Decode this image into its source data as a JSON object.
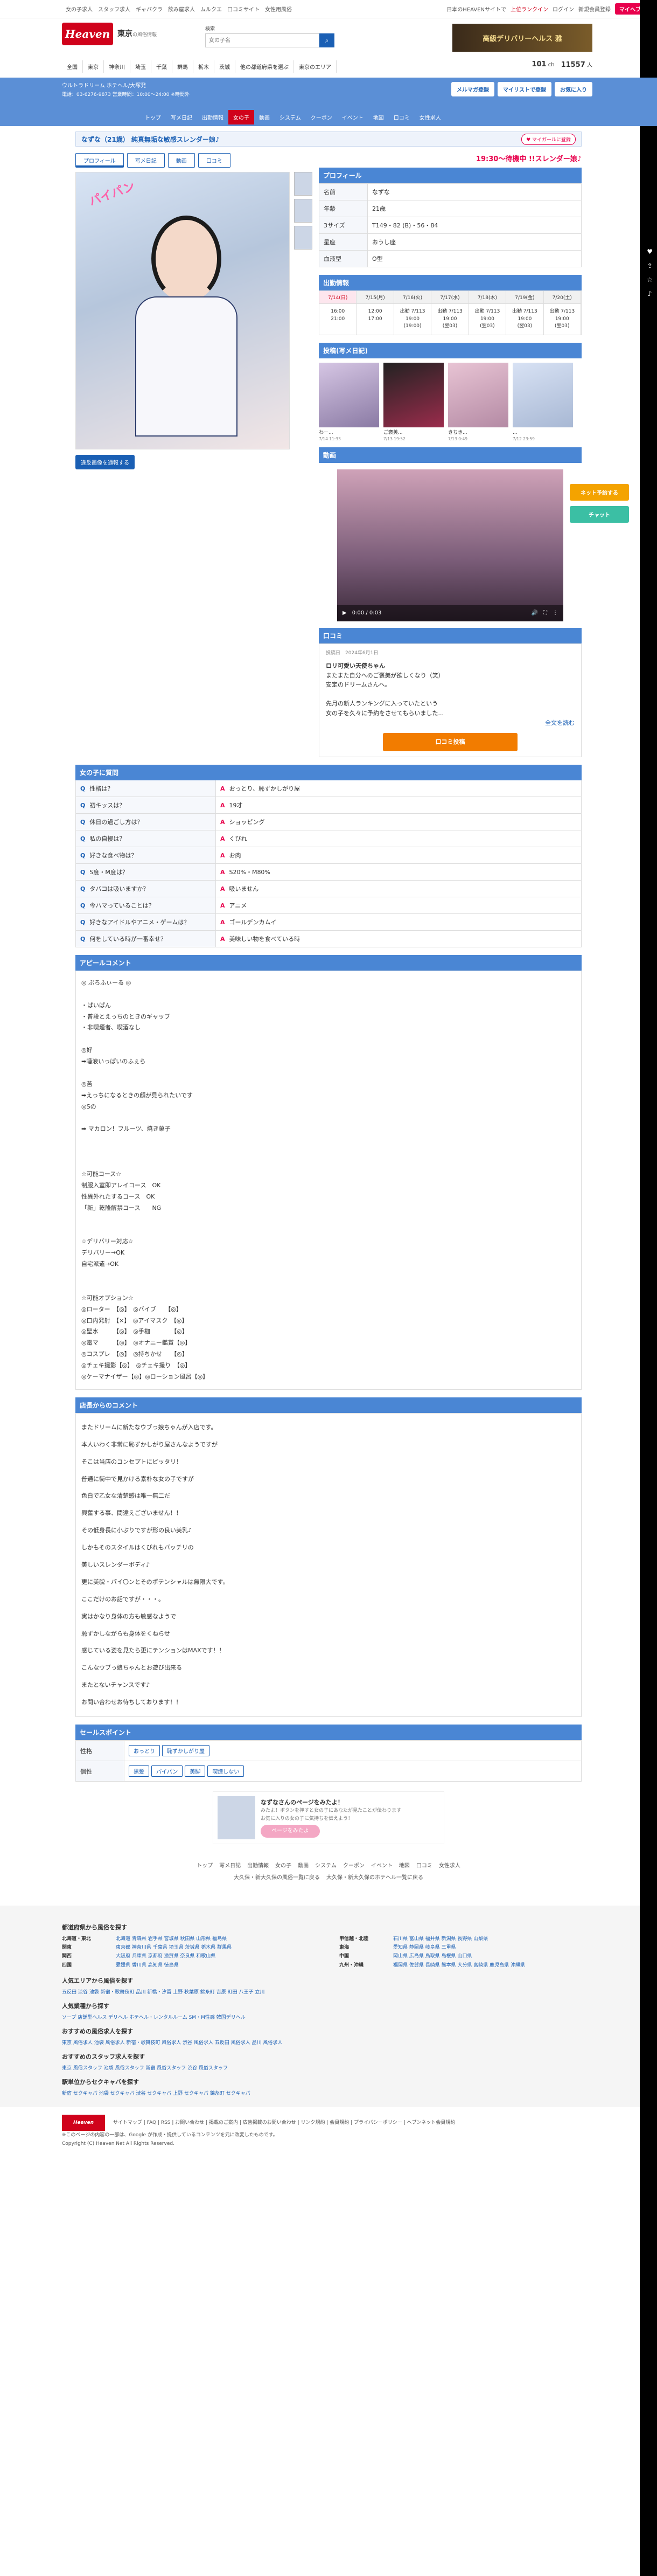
{
  "topbar": {
    "links": [
      "女の子求人",
      "スタッフ求人",
      "ギャバクラ",
      "飲み屋求人",
      "ムルクエ",
      "口コミサイト",
      "女性用風俗"
    ],
    "right_text": "日本のHEAVENサイトで",
    "ranking": "上位ランクイン",
    "login": "ログイン",
    "register": "新規会員登録",
    "mypage": "マイヘブン"
  },
  "header": {
    "logo": "Heaven",
    "region": "東京",
    "region_sub": "の風俗情報",
    "search_label": "検索",
    "search_placeholder": "女の子名",
    "banner_text": "高級デリバリーヘルス 雅",
    "gnav": [
      "全国",
      "東京",
      "神奈川",
      "埼玉",
      "千葉",
      "群馬",
      "栃木",
      "茨城",
      "他の都道府県を選ぶ",
      "東京のエリア"
    ],
    "count1": "101",
    "count1_unit": "ch",
    "count2": "11557",
    "count2_unit": "人"
  },
  "shop": {
    "name": "ウルトラドリーム ホテヘル/大塚発",
    "meta": "電話：03-6276-9873 営業時間：10:00～24:00 ※時間外",
    "btns": [
      "メルマガ登録",
      "マイリストで登録",
      "お気に入り"
    ],
    "nav": [
      "トップ",
      "写メ日記",
      "出勤情報",
      "女の子",
      "動画",
      "システム",
      "クーポン",
      "イベント",
      "地図",
      "口コミ",
      "女性求人"
    ],
    "active_nav": "女の子"
  },
  "girl": {
    "title": "なずな（21歳） 純真無垢な敏感スレンダー娘♪",
    "fav_btn": "♥ マイガールに登録",
    "status": "19:30〜待機中 !!スレンダー娘♪",
    "tabs": [
      "プロフィール",
      "写メ日記",
      "動画",
      "口コミ"
    ],
    "watermark": "パイパン",
    "return_btn": "違反画像を通報する"
  },
  "profile": {
    "header": "プロフィール",
    "rows": [
      {
        "k": "名前",
        "v": "なずな"
      },
      {
        "k": "年齢",
        "v": "21歳"
      },
      {
        "k": "3サイズ",
        "v": "T149・82 (B)・56・84"
      },
      {
        "k": "星座",
        "v": "おうし座"
      },
      {
        "k": "血液型",
        "v": "O型"
      }
    ]
  },
  "schedule": {
    "header": "出勤情報",
    "days": [
      "7/14(日)",
      "7/15(月)",
      "7/16(火)",
      "7/17(水)",
      "7/18(木)",
      "7/19(金)",
      "7/20(土)"
    ],
    "cells": [
      "16:00\n21:00",
      "12:00\n17:00",
      "出勤 7/113\n19:00\n(19:00)",
      "出勤 7/113\n19:00\n(翌03)",
      "出勤 7/113\n19:00\n(翌03)",
      "出勤 7/113\n19:00\n(翌03)",
      "出勤 7/113\n19:00\n(翌03)"
    ]
  },
  "diary": {
    "header": "投稿(写メ日記)",
    "items": [
      {
        "cap": "わー...",
        "date": "7/14 11:33"
      },
      {
        "cap": "ご褒美...",
        "date": "7/13 19:52"
      },
      {
        "cap": "きちき...",
        "date": "7/13 0:49"
      },
      {
        "cap": "...",
        "date": "7/12 23:59"
      }
    ]
  },
  "video": {
    "header": "動画",
    "time": "0:00 / 0:03"
  },
  "kuchikomi": {
    "header": "口コミ",
    "date_label": "投稿日",
    "date": "2024年6月1日",
    "title": "ロリ可愛い天使ちゃん",
    "body": "またまた自分へのご褒美が欲しくなり（笑）\n安定のドリームさんへ。\n\n先月の新人ランキングに入っていたという\n女の子を久々に予約をさせてもらいました...",
    "more": "全文を読む",
    "post_btn": "口コミ投稿"
  },
  "qa": {
    "header": "女の子に質問",
    "rows": [
      {
        "q": "性格は？",
        "a": "おっとり、恥ずかしがり屋"
      },
      {
        "q": "初キッスは？",
        "a": "19才"
      },
      {
        "q": "休日の過ごし方は？",
        "a": "ショッピング"
      },
      {
        "q": "私の自慢は？",
        "a": "くびれ"
      },
      {
        "q": "好きな食べ物は？",
        "a": "お肉"
      },
      {
        "q": "S度・M度は？",
        "a": "S20%・M80%"
      },
      {
        "q": "タバコは吸いますか？",
        "a": "吸いません"
      },
      {
        "q": "今ハマっていることは？",
        "a": "アニメ"
      },
      {
        "q": "好きなアイドルやアニメ・ゲームは？",
        "a": "ゴールデンカムイ"
      },
      {
        "q": "何をしている時が一番幸せ？",
        "a": "美味しい物を食べている時"
      }
    ]
  },
  "appeal": {
    "header": "アピールコメント",
    "text": "◎ ぷろふぃーる ◎\n\n・ぱいぱん\n・普段とえっちのときのギャップ\n・非喫煙者、喫酒なし\n\n◎好\n➡唾液いっぱいのふぇら\n\n◎苦\n➡えっちになるときの顔が見られたいです\n◎Sの\n\n➡ マカロン！フルーツ、焼き菓子\n\n\n\n☆可能コース☆\n制服入室即アレイコース　OK\n性異外れたするコース　OK\n「新」乾隆解禁コース　　NG\n\n\n☆デリバリー対応☆\nデリバリー→OK\n自宅派遣→OK\n\n\n☆可能オプション☆\n◎ローター　【◎】　◎バイブ　　【◎】\n◎口内発射　【×】　◎アイマスク　【◎】\n◎聖水　　　【◎】　◎手枷　　　　【◎】\n◎電マ　　　【◎】　◎オナニー鑑賞【◎】\n◎コスプレ　【◎】　◎持ちかせ　　【◎】\n◎チェキ撮影【◎】　◎チェキ撮り　【◎】\n◎ケーマナイザー【◎】◎ローション風呂【◎】"
  },
  "store_comment": {
    "header": "店長からのコメント",
    "lines": [
      "またドリームに新たなウブっ娘ちゃんが入店です。",
      "本人いわく非常に恥ずかしがり屋さんなようですが",
      "そこは当店のコンセプトにピッタリ！",
      "普通に街中で見かける素朴な女の子ですが",
      "色白で乙女な清楚感は唯一無二だ",
      "興奮する事、間違えございません！！",
      "その低身長に小ぶりですが形の良い美乳♪",
      "しかもそのスタイルはくびれもバッチリの",
      "美しいスレンダーボディ♪",
      "更に美貌・パイ〇ンとそのポテンシャルは無限大です。",
      "ここだけのお話ですが・・・。",
      "実はかなり身体の方も敏感なようで",
      "恥ずかしながらも身体をくねらせ",
      "感じている姿を見たら更にテンションはMAXです！！",
      "こんなウブっ娘ちゃんとお遊び出来る",
      "またとないチャンスです♪",
      "お問い合わせお待ちしております！！"
    ]
  },
  "sales": {
    "header": "セールスポイント",
    "rows": [
      {
        "k": "性格",
        "chips": [
          "おっとり",
          "恥ずかしがり屋"
        ]
      },
      {
        "k": "個性",
        "chips": [
          "黒髪",
          "パイパン",
          "美脚",
          "喫煙しない"
        ]
      }
    ]
  },
  "share": {
    "title": "なずなさんのページをみたよ！",
    "desc": "みたよ！ボタンを押すと女の子にあなたが見たことが伝わります\nお気に入りの女の子に気持ちを伝えよう！",
    "btn": "ページをみたよ"
  },
  "footlinks": {
    "row1": [
      "トップ",
      "写メ日記",
      "出勤情報",
      "女の子",
      "動画",
      "システム",
      "クーポン",
      "イベント",
      "地図",
      "口コミ",
      "女性求人"
    ],
    "row2": [
      "大久保・新大久保の風俗一覧に戻る",
      "大久保・新大久保のホテヘル一覧に戻る"
    ]
  },
  "area": {
    "h1": "都道府県から風俗を探す",
    "rows": [
      {
        "k": "北海道・東北",
        "v": "北海道 青森県 岩手県 宮城県 秋田県 山形県 福島県"
      },
      {
        "k": "関東",
        "v": "東京都 神奈川県 千葉県 埼玉県 茨城県 栃木県 群馬県"
      },
      {
        "k": "関西",
        "v": "大阪府 兵庫県 京都府 滋賀県 奈良県 和歌山県"
      },
      {
        "k": "四国",
        "v": "愛媛県 香川県 高知県 徳島県"
      },
      {
        "k": "甲信越・北陸",
        "v": "石川県 富山県 福井県 新潟県 長野県 山梨県"
      },
      {
        "k": "東海",
        "v": "愛知県 静岡県 岐阜県 三重県"
      },
      {
        "k": "中国",
        "v": "岡山県 広島県 鳥取県 島根県 山口県"
      },
      {
        "k": "九州・沖縄",
        "v": "福岡県 佐賀県 長崎県 熊本県 大分県 宮崎県 鹿児島県 沖縄県"
      }
    ],
    "h2": "人気エリアから風俗を探す",
    "pop": "五反田 渋谷 池袋 新宿・歌舞伎町 品川 新橋・汐留 上野 秋葉原 錦糸町 吉原 町田 八王子 立川",
    "h3": "人気業種から探す",
    "types": "ソープ 店舗型ヘルス デリヘル ホテヘル・レンタルルーム SM・M性感 韓国デリヘル",
    "h4": "おすすめの風俗求人を探す",
    "jobs": "東京 風俗求人 池袋 風俗求人 新宿・歌舞伎町 風俗求人 渋谷 風俗求人 五反田 風俗求人 品川 風俗求人",
    "h5": "おすすめのスタッフ求人を探す",
    "staff": "東京 風俗スタッフ 池袋 風俗スタッフ 新宿 風俗スタッフ 渋谷 風俗スタッフ",
    "h6": "駅単位からセクキャバを探す",
    "station": "新宿 セクキャバ 池袋 セクキャバ 渋谷 セクキャバ 上野 セクキャバ 錦糸町 セクキャバ"
  },
  "footer": {
    "logo": "Heaven",
    "links": "サイトマップ | FAQ | RSS | お問い合わせ | 掲載のご案内 | 広告掲載のお問い合わせ | リンク規約 | 会員規約 | プライバシーポリシー | ヘブンネット会員規約",
    "note": "※このページの内容の一部は、Google が作成・提供しているコンテンツを元に改変したものです。",
    "copyright": "Copyright (C) Heaven Net All Rights Reserved."
  },
  "side": {
    "btn1": "ネット予約する",
    "btn1_color": "#f4a300",
    "btn2": "チャット",
    "btn2_color": "#3bbfa4"
  }
}
